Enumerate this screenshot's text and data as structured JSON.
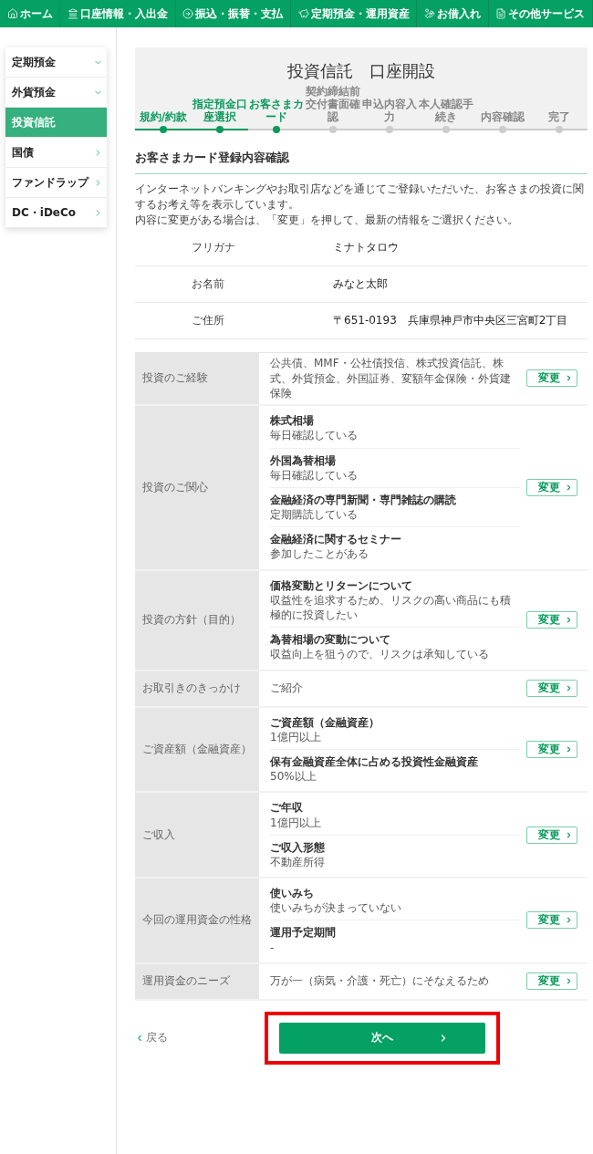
{
  "nav": [
    {
      "label": "ホーム"
    },
    {
      "label": "口座情報・入出金"
    },
    {
      "label": "振込・振替・支払"
    },
    {
      "label": "定期預金・運用資産"
    },
    {
      "label": "お借入れ"
    },
    {
      "label": "その他サービス"
    }
  ],
  "sidebar": {
    "items": [
      {
        "label": "定期預金",
        "kind": "dropdown",
        "selected": false
      },
      {
        "label": "外貨預金",
        "kind": "dropdown",
        "selected": false
      },
      {
        "label": "投資信託",
        "selected": true
      },
      {
        "label": "国債",
        "kind": "link",
        "selected": false
      },
      {
        "label": "ファンドラップ",
        "kind": "link",
        "selected": false
      },
      {
        "label": "DC・iDeCo",
        "kind": "link",
        "selected": false
      }
    ]
  },
  "header": {
    "title": "投資信託　口座開設",
    "steps": [
      {
        "label": "規約/約款",
        "done": true
      },
      {
        "label": "指定預金口座選択",
        "done": true
      },
      {
        "label": "お客さまカード",
        "done": true
      },
      {
        "label": "契約締結前交付書面確認",
        "done": false
      },
      {
        "label": "申込内容入力",
        "done": false
      },
      {
        "label": "本人確認手続き",
        "done": false
      },
      {
        "label": "内容確認",
        "done": false
      },
      {
        "label": "完了",
        "done": false
      }
    ]
  },
  "section": {
    "heading": "お客さまカード登録内容確認",
    "description": [
      "インターネットバンキングやお取引店などを通じてご登録いただいた、お客さまの投資に関するお考え等を表示しています。",
      "内容に変更がある場合は、「変更」を押して、最新の情報をご選択ください。"
    ]
  },
  "profile": [
    {
      "label": "フリガナ",
      "value": "ミナトタロウ"
    },
    {
      "label": "お名前",
      "value": "みなと太郎"
    },
    {
      "label": "ご住所",
      "value": "〒651-0193　兵庫県神戸市中央区三宮町2丁目"
    }
  ],
  "answers": [
    {
      "label": "投資のご経験",
      "kind": "text",
      "text": "公共債、MMF・公社債投信、株式投資信託、株式、外貨預金、外国証券、変額年金保険・外貨建保険",
      "button": "変更"
    },
    {
      "label": "投資のご関心",
      "kind": "list",
      "items": [
        {
          "title": "株式相場",
          "value": "毎日確認している"
        },
        {
          "title": "外国為替相場",
          "value": "毎日確認している"
        },
        {
          "title": "金融経済の専門新聞・専門雑誌の購読",
          "value": "定期購読している"
        },
        {
          "title": "金融経済に関するセミナー",
          "value": "参加したことがある"
        }
      ],
      "button": "変更"
    },
    {
      "label": "投資の方針（目的）",
      "kind": "list",
      "items": [
        {
          "title": "価格変動とリターンについて",
          "value": "収益性を追求するため、リスクの高い商品にも積極的に投資したい"
        },
        {
          "title": "為替相場の変動について",
          "value": "収益向上を狙うので、リスクは承知している"
        }
      ],
      "button": "変更"
    },
    {
      "label": "お取引きのきっかけ",
      "kind": "text",
      "text": "ご紹介",
      "button": "変更"
    },
    {
      "label": "ご資産額（金融資産）",
      "kind": "list",
      "items": [
        {
          "title": "ご資産額（金融資産）",
          "value": "1億円以上"
        },
        {
          "title": "保有金融資産全体に占める投資性金融資産",
          "value": "50%以上"
        }
      ],
      "button": "変更"
    },
    {
      "label": "ご収入",
      "kind": "list",
      "items": [
        {
          "title": "ご年収",
          "value": "1億円以上"
        },
        {
          "title": "ご収入形態",
          "value": "不動産所得"
        }
      ],
      "button": "変更"
    },
    {
      "label": "今回の運用資金の性格",
      "kind": "list",
      "items": [
        {
          "title": "使いみち",
          "value": "使いみちが決まっていない"
        },
        {
          "title": "運用予定期間",
          "value": "-"
        }
      ],
      "button": "変更"
    },
    {
      "label": "運用資金のニーズ",
      "kind": "text",
      "text": "万が一（病気・介護・死亡）にそなえるため",
      "button": "変更"
    }
  ],
  "footer": {
    "back": "戻る",
    "next": {
      "label": "次へ",
      "highlighted": true
    }
  }
}
